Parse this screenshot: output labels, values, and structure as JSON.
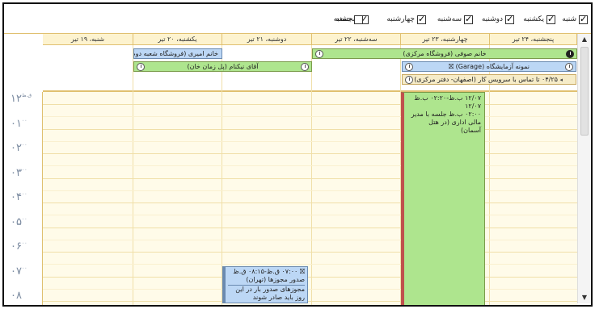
{
  "filters": [
    {
      "label": "شنبه",
      "checked": true
    },
    {
      "label": "یکشنبه",
      "checked": true
    },
    {
      "label": "دوشنبه",
      "checked": true
    },
    {
      "label": "سه‌شنبه",
      "checked": true
    },
    {
      "label": "چهارشنبه",
      "checked": true
    },
    {
      "label": "پنجشنبه",
      "checked": true
    },
    {
      "label": "جمعه",
      "checked": false
    }
  ],
  "days": [
    "پنجشنبه، ۲۴ تیر",
    "چهارشنبه، ۲۳ تیر",
    "سه‌شنبه، ۲۲ تیر",
    "دوشنبه، ۲۱ تیر",
    "یکشنبه، ۲۰ تیر",
    "شنبه، ۱۹ تیر"
  ],
  "allday_events": [
    {
      "text": "خانم صوفی (فروشگاه مرکزی)",
      "color": "#aee58e"
    },
    {
      "text": "نمونه آزمایشگاه (Garage)",
      "color": "#bcd7f5"
    },
    {
      "text": "تماس با سرویس کار (اصفهان- دفتر مرکزی)",
      "prefix": "۰۴/۲۵ تا",
      "color": "#f6ecc8"
    },
    {
      "text": "خانم امیری (فروشگاه شعبه دوم)",
      "color": "#bcd7f5"
    },
    {
      "text": "آقای نیکنام (پل زمان خان)",
      "color": "#aee58e"
    }
  ],
  "hours": [
    {
      "num": "۱۲",
      "suffix": "ق.ظ"
    },
    {
      "num": "۰۱",
      "suffix": "۰۰"
    },
    {
      "num": "۰۲",
      "suffix": "۰۰"
    },
    {
      "num": "۰۳",
      "suffix": "۰۰"
    },
    {
      "num": "۰۴",
      "suffix": "۰۰"
    },
    {
      "num": "۰۵",
      "suffix": "۰۰"
    },
    {
      "num": "۰۶",
      "suffix": "۰۰"
    },
    {
      "num": "۰۷",
      "suffix": "۰۰"
    },
    {
      "num": "۰۸",
      "suffix": ""
    }
  ],
  "appointments": {
    "green_lines": [
      "۱۲/۰۷ ب.ظ-۰۲:۲۰ ب.ظ ۱۲/۰۷",
      "۰۲:۰۰ ب.ظ جلسه با مدیر",
      "مالی اداری (در هتل آسمان)"
    ],
    "blue_title": "۰۷:۰۰ ق.ظ-۰۸:۱۵ ق.ظ",
    "blue_lines": [
      "صدور مجوزها (تهران)",
      "مجوزهای صدور بار در این",
      "روز باید صادر شوند"
    ]
  },
  "colors": {
    "green": "#aee58e",
    "blue": "#bcd7f5",
    "tan": "#f6ecc8",
    "accent": "#c0504d"
  }
}
